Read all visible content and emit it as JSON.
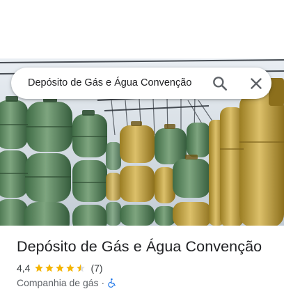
{
  "search": {
    "query": "Depósito de Gás e Água Convenção"
  },
  "place": {
    "name": "Depósito de Gás e Água Convenção",
    "rating": "4,4",
    "stars_filled": 4.5,
    "stars_total": 5,
    "review_count": "(7)",
    "category": "Companhia de gás",
    "separator": "·",
    "accessibility_icon": "wheelchair-accessible-icon"
  },
  "colors": {
    "star": "#f4b400",
    "accessibility": "#1a73e8",
    "gas_cylinder_green": "#5f8a62",
    "gas_cylinder_yellow": "#c8a53c"
  },
  "hero_image": {
    "subject": "gas-cylinders-photo"
  }
}
